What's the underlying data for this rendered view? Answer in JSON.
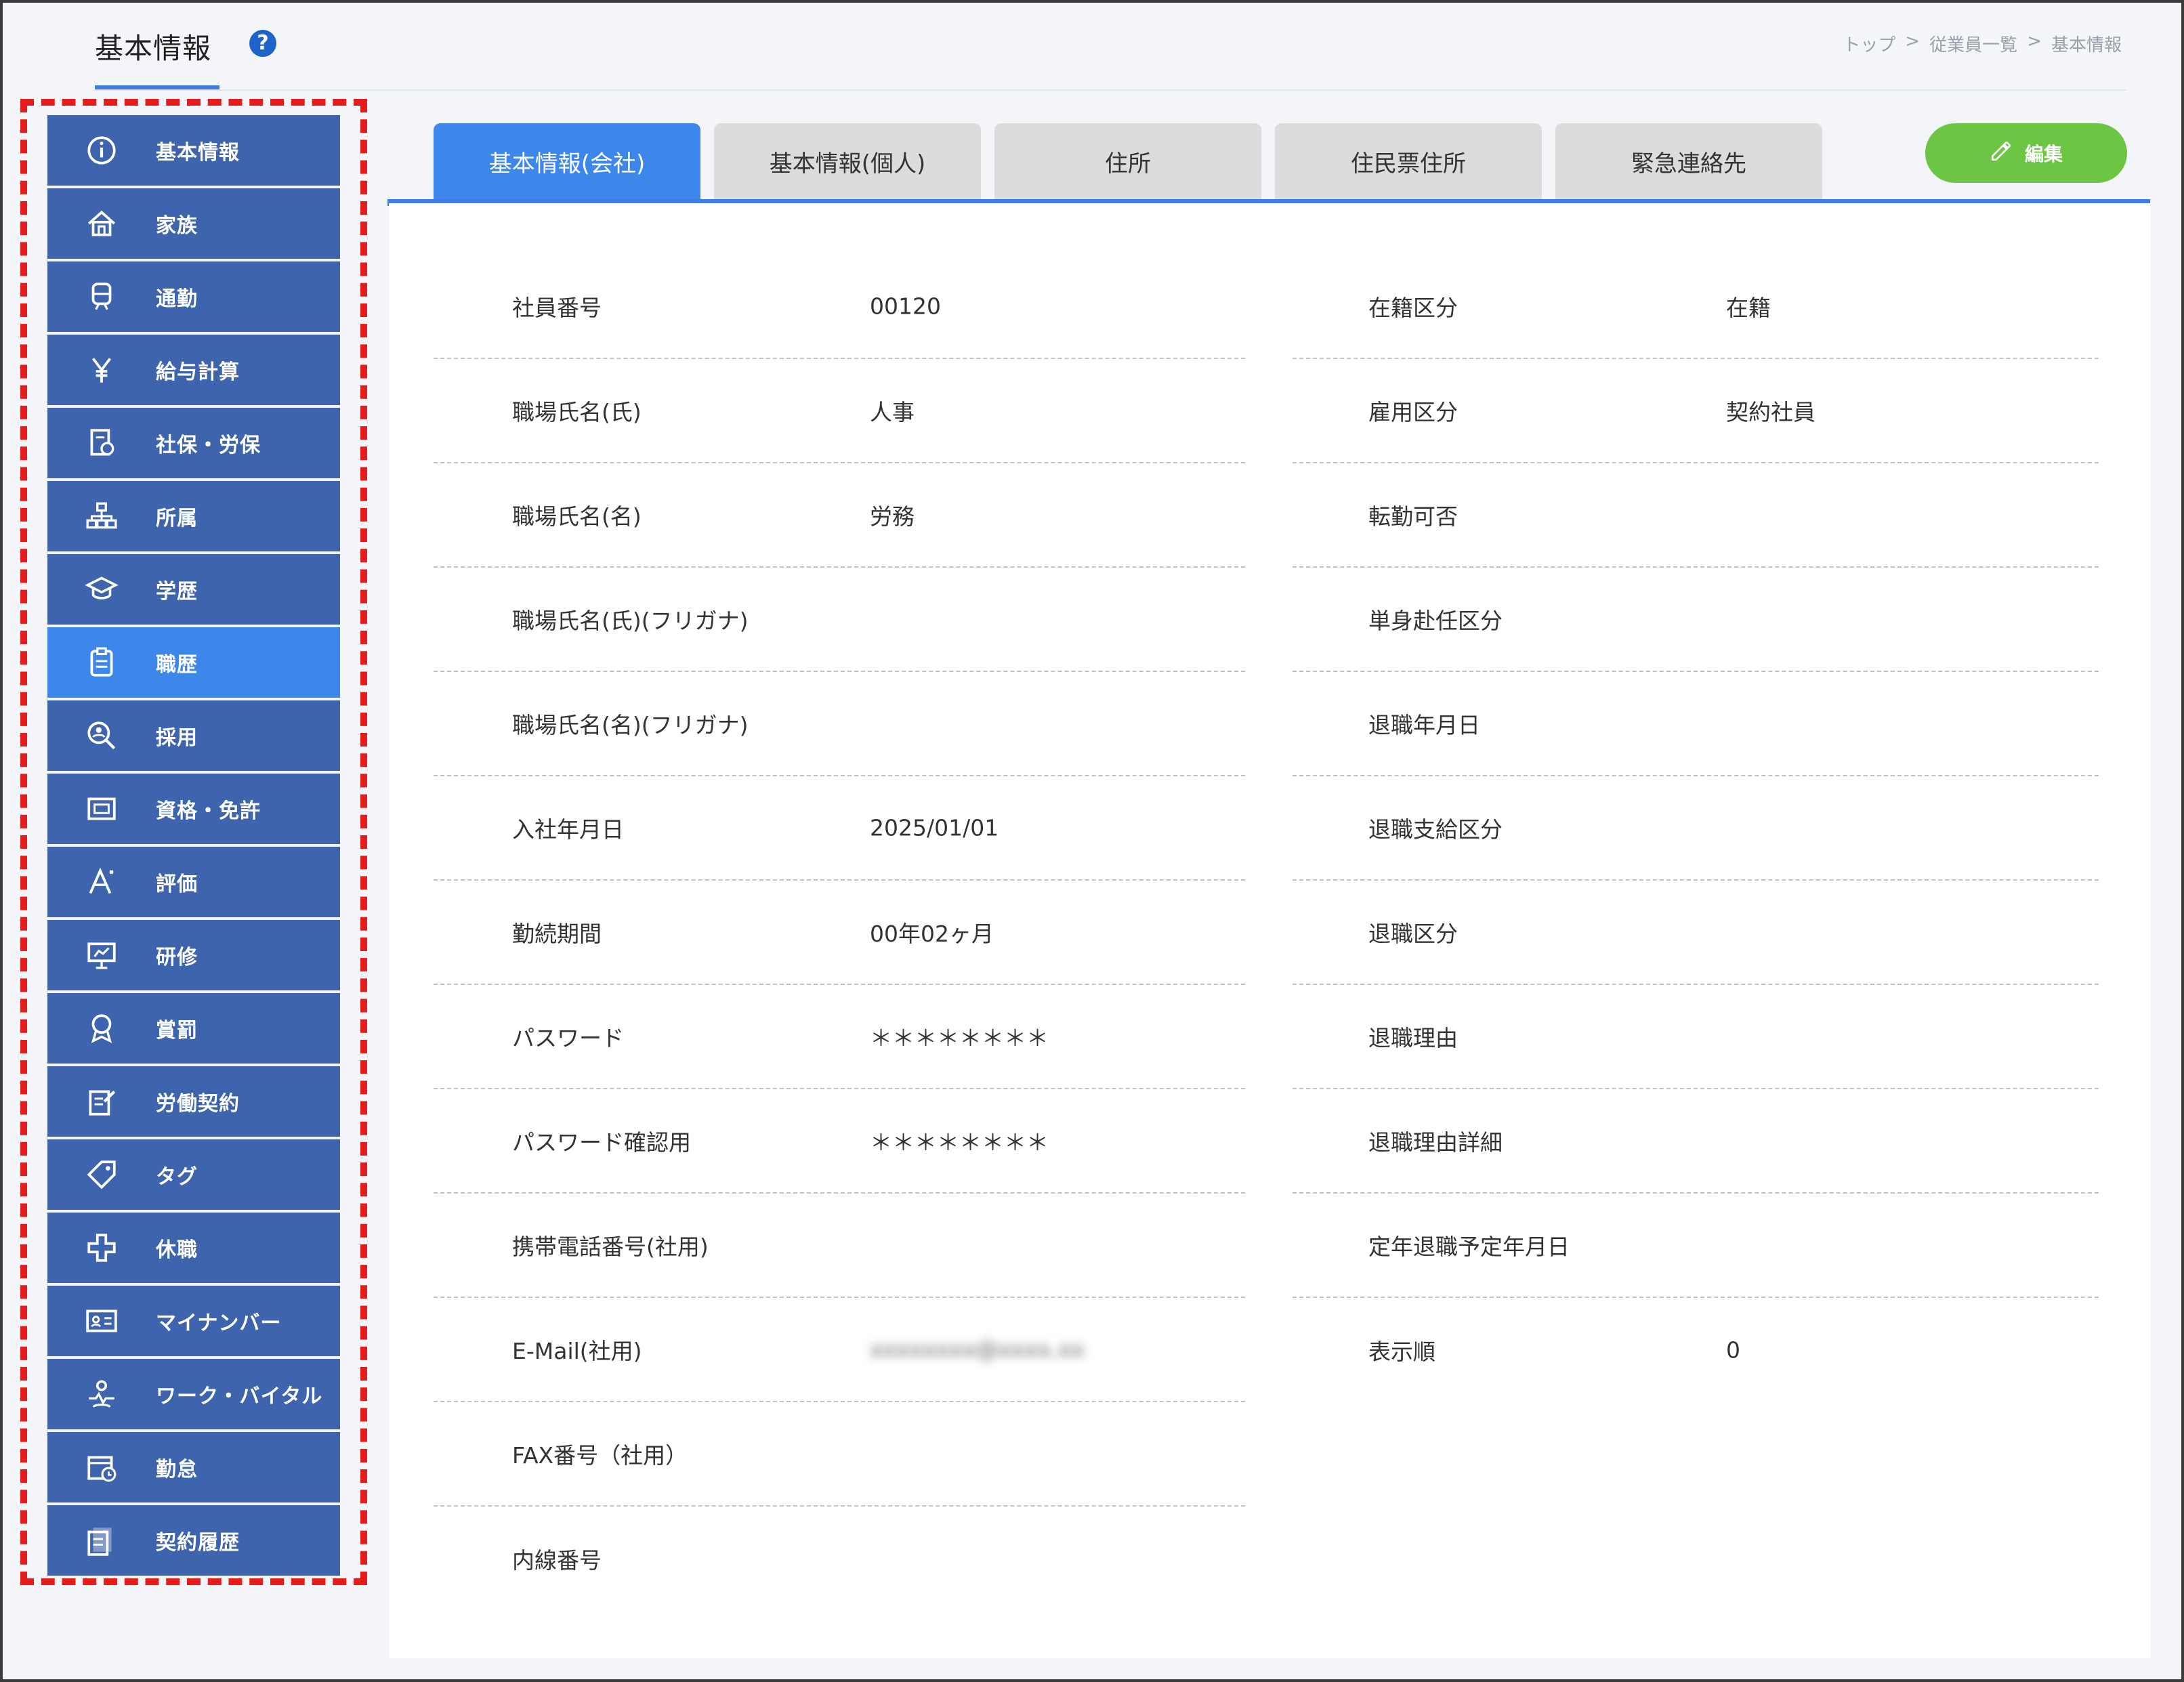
{
  "header": {
    "title": "基本情報",
    "help_icon": "?",
    "breadcrumb": [
      "トップ",
      "従業員一覧",
      "基本情報"
    ],
    "breadcrumb_sep": ">"
  },
  "sidebar": {
    "items": [
      {
        "label": "基本情報",
        "icon": "info-icon"
      },
      {
        "label": "家族",
        "icon": "house-icon"
      },
      {
        "label": "通勤",
        "icon": "train-icon"
      },
      {
        "label": "給与計算",
        "icon": "yen-icon"
      },
      {
        "label": "社保・労保",
        "icon": "insurance-doc-icon"
      },
      {
        "label": "所属",
        "icon": "org-chart-icon"
      },
      {
        "label": "学歴",
        "icon": "graduation-cap-icon"
      },
      {
        "label": "職歴",
        "icon": "clipboard-icon"
      },
      {
        "label": "採用",
        "icon": "search-person-icon"
      },
      {
        "label": "資格・免許",
        "icon": "license-card-icon"
      },
      {
        "label": "評価",
        "icon": "evaluation-icon"
      },
      {
        "label": "研修",
        "icon": "presentation-board-icon"
      },
      {
        "label": "賞罰",
        "icon": "medal-icon"
      },
      {
        "label": "労働契約",
        "icon": "contract-edit-icon"
      },
      {
        "label": "タグ",
        "icon": "tag-icon"
      },
      {
        "label": "休職",
        "icon": "medical-cross-icon"
      },
      {
        "label": "マイナンバー",
        "icon": "id-card-icon"
      },
      {
        "label": "ワーク・バイタル",
        "icon": "vital-person-icon"
      },
      {
        "label": "勤怠",
        "icon": "calendar-clock-icon"
      },
      {
        "label": "契約履歴",
        "icon": "document-history-icon"
      }
    ],
    "active_index": 7,
    "colors": {
      "item": "#3e64ad",
      "active": "#3d86ea",
      "outline": "#e51c1c"
    }
  },
  "tabs": [
    {
      "label": "基本情報(会社)",
      "active": true
    },
    {
      "label": "基本情報(個人)",
      "active": false
    },
    {
      "label": "住所",
      "active": false
    },
    {
      "label": "住民票住所",
      "active": false
    },
    {
      "label": "緊急連絡先",
      "active": false
    }
  ],
  "edit_button": {
    "label": "編集",
    "icon": "pencil-icon",
    "color": "#6cc644"
  },
  "fields_left": [
    {
      "label": "社員番号",
      "value": "00120"
    },
    {
      "label": "職場氏名(氏)",
      "value": "人事"
    },
    {
      "label": "職場氏名(名)",
      "value": "労務"
    },
    {
      "label": "職場氏名(氏)(フリガナ)",
      "value": ""
    },
    {
      "label": "職場氏名(名)(フリガナ)",
      "value": ""
    },
    {
      "label": "入社年月日",
      "value": "2025/01/01"
    },
    {
      "label": "勤続期間",
      "value": "00年02ヶ月"
    },
    {
      "label": "パスワード",
      "value": "＊＊＊＊＊＊＊＊"
    },
    {
      "label": "パスワード確認用",
      "value": "＊＊＊＊＊＊＊＊"
    },
    {
      "label": "携帯電話番号(社用)",
      "value": ""
    },
    {
      "label": "E-Mail(社用)",
      "value": "xxxxxxxx@xxxx.xx",
      "blurred": true
    },
    {
      "label": "FAX番号（社用）",
      "value": ""
    },
    {
      "label": "内線番号",
      "value": ""
    }
  ],
  "fields_right": [
    {
      "label": "在籍区分",
      "value": "在籍"
    },
    {
      "label": "雇用区分",
      "value": "契約社員"
    },
    {
      "label": "転勤可否",
      "value": ""
    },
    {
      "label": "単身赴任区分",
      "value": ""
    },
    {
      "label": "退職年月日",
      "value": ""
    },
    {
      "label": "退職支給区分",
      "value": ""
    },
    {
      "label": "退職区分",
      "value": ""
    },
    {
      "label": "退職理由",
      "value": ""
    },
    {
      "label": "退職理由詳細",
      "value": ""
    },
    {
      "label": "定年退職予定年月日",
      "value": ""
    },
    {
      "label": "表示順",
      "value": "0"
    }
  ]
}
